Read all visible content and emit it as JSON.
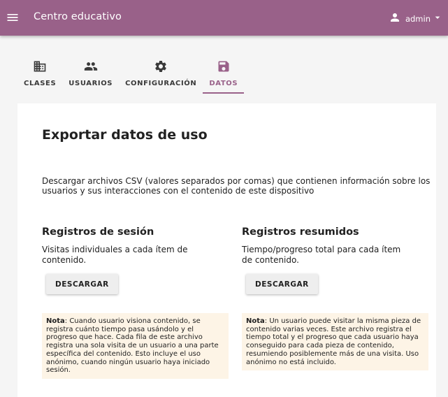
{
  "appbar": {
    "title": "Centro educativo",
    "menu_icon": "menu-icon",
    "user_icon": "person-icon",
    "username": "admin",
    "dropdown_icon": "arrow-drop-down-icon",
    "color": "#996189"
  },
  "tabs": [
    {
      "label": "CLASES",
      "icon": "domain-icon"
    },
    {
      "label": "USUARIOS",
      "icon": "people-icon"
    },
    {
      "label": "CONFIGURACIÓN",
      "icon": "gear-icon"
    },
    {
      "label": "DATOS",
      "icon": "save-icon",
      "active": true
    }
  ],
  "main": {
    "title": "Exportar datos de uso",
    "description": "Descargar archivos CSV (valores separados por comas) que contienen información sobre los usuarios y sus interacciones con el contenido de este dispositivo",
    "sections": [
      {
        "title": "Registros de sesión",
        "subtitle": "Visitas individuales a cada ítem de contenido.",
        "button": "DESCARGAR",
        "note_label": "Nota",
        "note_text": ": Cuando usuario visiona contenido, se registra cuánto tiempo pasa usándolo y el progreso que hace. Cada fila de este archivo registra una sola visita de un usuario a una parte específica del contenido. Esto incluye el uso anónimo, cuando ningún usuario haya iniciado sesión."
      },
      {
        "title": "Registros resumidos",
        "subtitle": "Tiempo/progreso total para cada ítem de contenido.",
        "button": "DESCARGAR",
        "note_label": "Nota",
        "note_text": ": Un usuario puede visitar la misma pieza de contenido varias veces. Este archivo registra el tiempo total y el progreso que cada usuario haya conseguido para cada pieza de contenido, resumiendo posiblemente más de una visita. Uso anónimo no está incluido."
      }
    ]
  }
}
